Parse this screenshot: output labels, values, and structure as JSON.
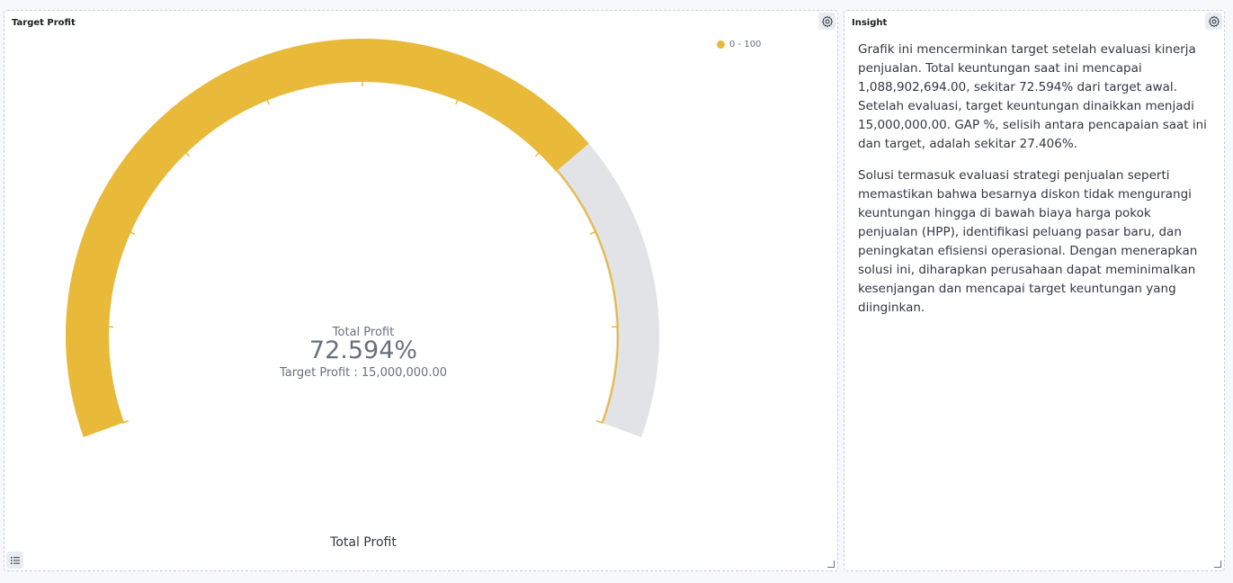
{
  "colors": {
    "accent": "#e9b93a",
    "track": "#e1e3e7",
    "text_muted": "#69707d"
  },
  "target_panel": {
    "title": "Target Profit",
    "legend": {
      "label": "0 - 100"
    },
    "gauge": {
      "title": "Total Profit",
      "value_text": "72.594%",
      "subtitle": "Target Profit : 15,000,000.00"
    },
    "footer_label": "Total Profit"
  },
  "insight_panel": {
    "title": "Insight",
    "paragraphs": [
      "Grafik ini mencerminkan target setelah evaluasi kinerja penjualan. Total keuntungan saat ini mencapai 1,088,902,694.00, sekitar 72.594% dari target awal. Setelah evaluasi, target keuntungan dinaikkan menjadi 15,000,000.00. GAP %, selisih antara pencapaian saat ini dan target, adalah sekitar 27.406%.",
      "Solusi termasuk evaluasi strategi penjualan seperti memastikan bahwa besarnya diskon tidak mengurangi keuntungan hingga di bawah biaya harga pokok penjualan (HPP), identifikasi peluang pasar baru, dan peningkatan efisiensi operasional. Dengan menerapkan solusi ini, diharapkan perusahaan dapat meminimalkan kesenjangan dan mencapai target keuntungan yang diinginkan."
    ]
  },
  "chart_data": {
    "type": "gauge",
    "value": 72.594,
    "min": 0,
    "max": 100,
    "title": "Total Profit",
    "legend": [
      "0 - 100"
    ],
    "legend_position": "top-right"
  }
}
